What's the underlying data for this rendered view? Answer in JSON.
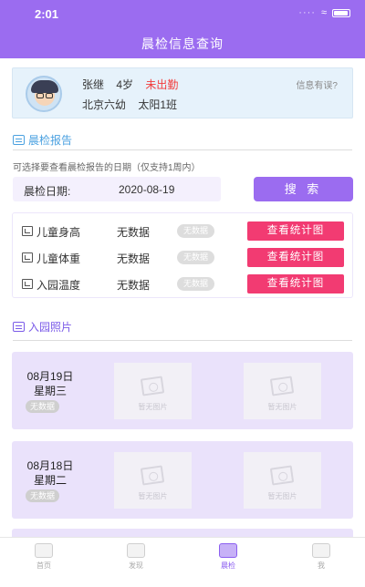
{
  "status_bar": {
    "time": "2:01",
    "signal": "····",
    "wifi": "wifi-icon"
  },
  "header": {
    "title": "晨检信息查询",
    "accent_color": "#9b6cf0"
  },
  "child": {
    "name": "张继",
    "age": "4岁",
    "attendance": "未出勤",
    "school": "北京六幼",
    "class": "太阳1班",
    "feedback_link": "信息有误?"
  },
  "report": {
    "section_title": "晨检报告",
    "hint": "可选择要查看晨检报告的日期（仅支持1周内）",
    "date_label": "晨检日期:",
    "date_value": "2020-08-19",
    "search_label": "搜 索",
    "metrics": [
      {
        "name": "儿童身高",
        "value": "无数据",
        "badge": "无数据",
        "button": "查看统计图"
      },
      {
        "name": "儿童体重",
        "value": "无数据",
        "badge": "无数据",
        "button": "查看统计图"
      },
      {
        "name": "入园温度",
        "value": "无数据",
        "badge": "无数据",
        "button": "查看统计图"
      }
    ]
  },
  "photos": {
    "section_title": "入园照片",
    "days": [
      {
        "date": "08月19日",
        "weekday": "星期三",
        "badge": "无数据",
        "placeholder_1": "暂无图片",
        "placeholder_2": "暂无图片"
      },
      {
        "date": "08月18日",
        "weekday": "星期二",
        "badge": "无数据",
        "placeholder_1": "暂无图片",
        "placeholder_2": "暂无图片"
      }
    ]
  },
  "tabbar": {
    "tabs": [
      {
        "label": "首页",
        "icon": "home-icon"
      },
      {
        "label": "发现",
        "icon": "discover-icon"
      },
      {
        "label": "晨检",
        "icon": "checkup-icon",
        "active": true
      },
      {
        "label": "我",
        "icon": "profile-icon"
      }
    ]
  }
}
